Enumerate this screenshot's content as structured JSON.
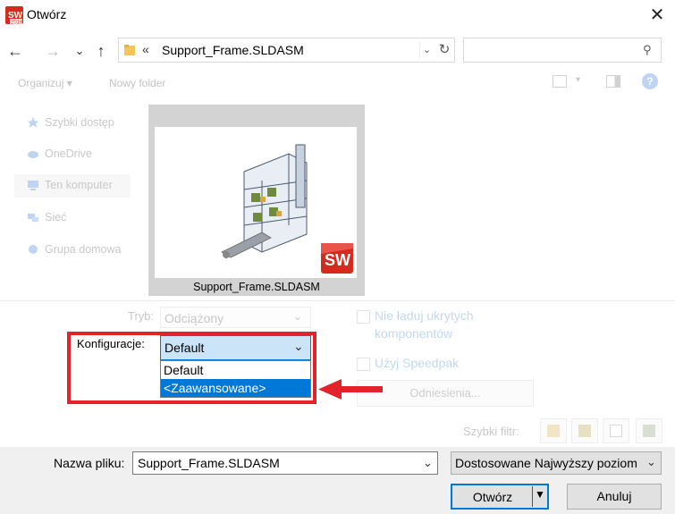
{
  "window": {
    "title": "Otwórz",
    "close_glyph": "✕",
    "app_icon": "solidworks-2018-icon"
  },
  "nav": {
    "back_glyph": "←",
    "forward_glyph": "→",
    "recent_glyph": "⌄",
    "up_glyph": "↑",
    "address_chevron": "«",
    "address_path": "Support_Frame.SLDASM",
    "address_dropdown_glyph": "⌄",
    "refresh_glyph": "↻",
    "search_placeholder": "",
    "search_glyph": "⚲"
  },
  "toolbar": {
    "organize_label": "Organizuj ▾",
    "new_folder_label": "Nowy folder"
  },
  "sidebar": {
    "items": [
      {
        "label": "Szybki dostęp",
        "icon": "star-icon"
      },
      {
        "label": "OneDrive",
        "icon": "cloud-icon"
      },
      {
        "label": "Ten komputer",
        "icon": "computer-icon"
      },
      {
        "label": "Sieć",
        "icon": "network-icon"
      },
      {
        "label": "Grupa domowa",
        "icon": "homegroup-icon"
      }
    ]
  },
  "preview": {
    "caption": "Support_Frame.SLDASM",
    "logo_text": "SW"
  },
  "options": {
    "mode_label": "Tryb:",
    "mode_value": "Odciążony",
    "config_label": "Konfiguracje:",
    "config_selected": "Default",
    "config_options": [
      "Default",
      "<Zaawansowane>"
    ],
    "config_highlighted_index": 1,
    "skip_hidden_label_1": "Nie ładuj ukrytych",
    "skip_hidden_label_2": "komponentów",
    "speedpak_label": "Użyj Speedpak",
    "references_label": "Odniesienia...",
    "quick_filter_label": "Szybki filtr:"
  },
  "footer": {
    "filename_label": "Nazwa pliku:",
    "filename_value": "Support_Frame.SLDASM",
    "filetype_value": "Dostosowane Najwyższy poziom",
    "open_label": "Otwórz",
    "cancel_label": "Anuluj"
  },
  "colors": {
    "highlight_border": "#e2232b",
    "accent": "#0078d7",
    "selection_bg": "#cce4f7"
  }
}
